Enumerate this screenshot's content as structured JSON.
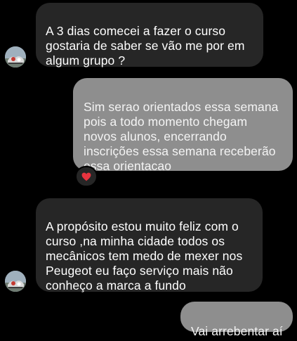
{
  "conversation": {
    "messages": [
      {
        "direction": "incoming",
        "text": "A 3 dias comecei a fazer o curso\ngostaria de saber se vão me por em\nalgum grupo ?"
      },
      {
        "direction": "outgoing",
        "text": "Sim serao orientados essa semana\npois a todo momento chegam\nnovos alunos, encerrando\ninscrições essa semana receberão\nessa orientacao",
        "reaction": "red-heart"
      },
      {
        "direction": "incoming",
        "text": "A propósito estou muito feliz com o\ncurso ,na minha cidade todos os\nmecânicos tem medo de mexer nos\nPeugeot eu faço serviço mais não\nconheço a marca a fundo"
      },
      {
        "direction": "outgoing",
        "text": "Vai arrebentar aí"
      }
    ]
  },
  "colors": {
    "background": "#000000",
    "incoming_bubble": "#262626",
    "outgoing_bubble": "#8e8e8e",
    "heart": "#e8343f"
  }
}
